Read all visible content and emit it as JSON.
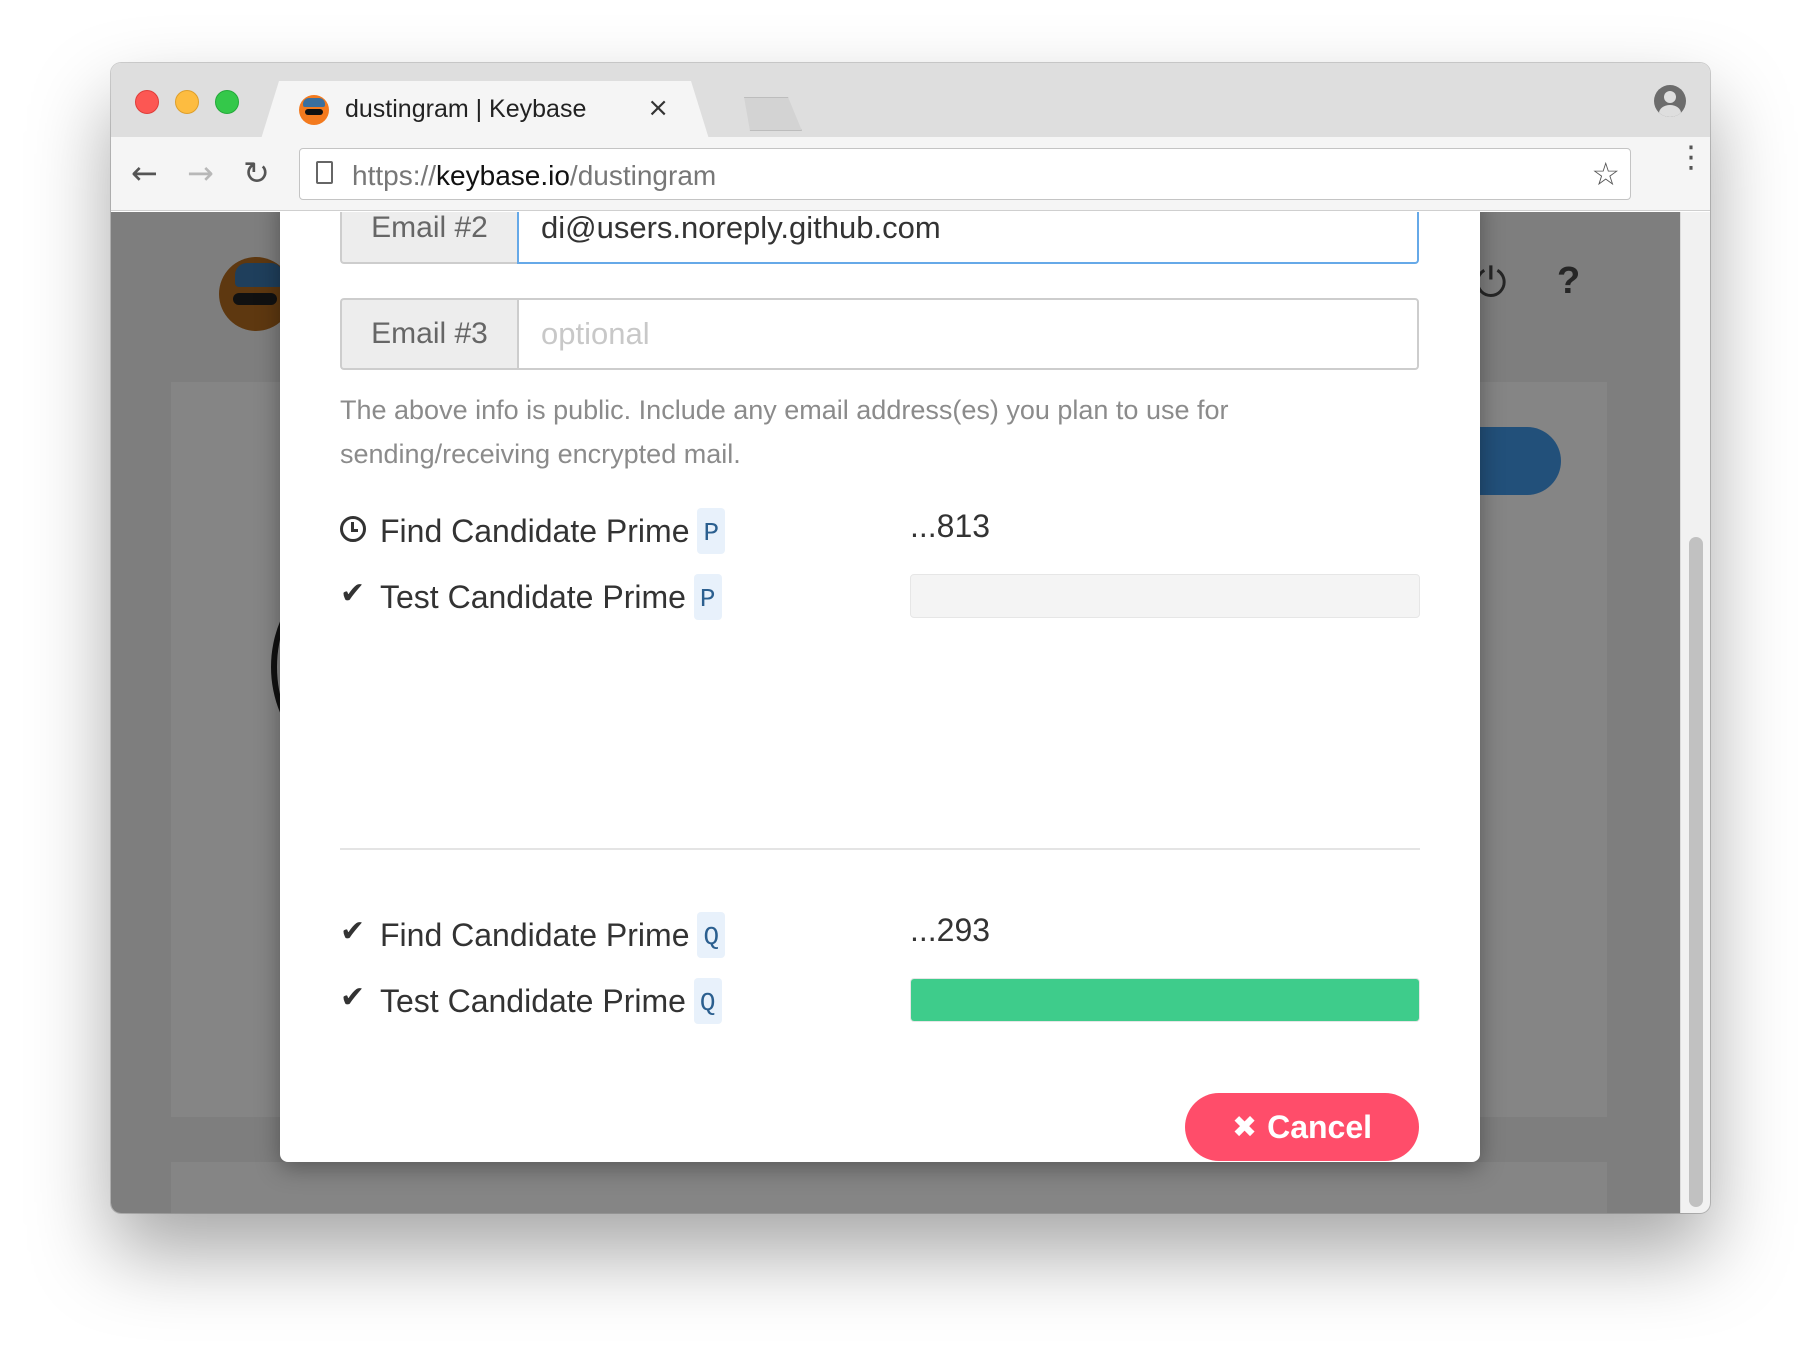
{
  "browser": {
    "tab": {
      "title": "dustingram | Keybase",
      "close": "×",
      "favicon": "keybase-logo"
    },
    "url": {
      "scheme": "https://",
      "host": "keybase.io",
      "path": "/dustingram"
    },
    "icons": {
      "back": "←",
      "forward": "→",
      "reload": "↻",
      "star": "☆",
      "menu": "⋮"
    }
  },
  "background": {
    "power_icon": "⏻",
    "help_icon": "?",
    "caret": "▾"
  },
  "modal": {
    "emails": [
      {
        "label": "Email #2",
        "value": "di@users.noreply.github.com",
        "placeholder": ""
      },
      {
        "label": "Email #3",
        "value": "",
        "placeholder": "optional"
      }
    ],
    "info_text": "The above info is public. Include any email address(es) you plan to use for sending/receiving encrypted mail.",
    "steps": [
      {
        "status": "pending",
        "icon": "clock-icon",
        "label": "Find Candidate Prime",
        "badge": "P",
        "value": "...813"
      },
      {
        "status": "done",
        "icon": "✔",
        "label": "Test Candidate Prime",
        "badge": "P",
        "progress": 0.0
      },
      {
        "status": "done",
        "icon": "✔",
        "label": "Find Candidate Prime",
        "badge": "Q",
        "value": "...293"
      },
      {
        "status": "done",
        "icon": "✔",
        "label": "Test Candidate Prime",
        "badge": "Q",
        "progress": 1.0
      }
    ],
    "cancel": {
      "icon": "✖",
      "label": "Cancel"
    }
  },
  "colors": {
    "progress_fill": "#3ecc8b",
    "cancel_button": "#ff4d6a",
    "focus_border": "#66a9e8",
    "badge_bg": "#e8f1fb"
  }
}
